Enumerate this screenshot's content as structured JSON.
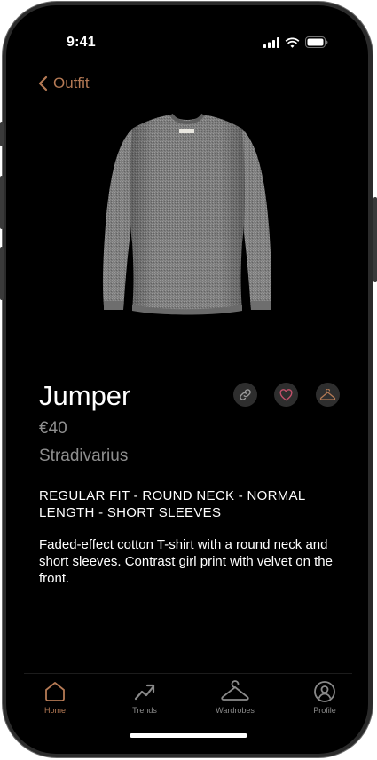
{
  "status_bar": {
    "time": "9:41"
  },
  "nav": {
    "back_label": "Outfit"
  },
  "product": {
    "title": "Jumper",
    "price": "€40",
    "brand": "Stradivarius",
    "features": "REGULAR FIT - ROUND NECK - NORMAL LENGTH - SHORT SLEEVES",
    "description": "Faded-effect cotton T-shirt with a round neck and short sleeves. Contrast girl print with velvet on the front.",
    "image_icon": "grey-knit-jumper"
  },
  "actions": [
    {
      "icon": "link-icon"
    },
    {
      "icon": "heart-icon"
    },
    {
      "icon": "hanger-icon"
    }
  ],
  "tab_bar": {
    "tabs": [
      {
        "label": "Home",
        "icon": "home-icon",
        "active": true
      },
      {
        "label": "Trends",
        "icon": "trend-icon",
        "active": false
      },
      {
        "label": "Wardrobes",
        "icon": "hanger-icon",
        "active": false
      },
      {
        "label": "Profile",
        "icon": "profile-icon",
        "active": false
      }
    ]
  },
  "colors": {
    "accent": "#b57a55",
    "heart": "#c2506a",
    "background": "#000000",
    "muted_text": "#8e8e8e"
  }
}
